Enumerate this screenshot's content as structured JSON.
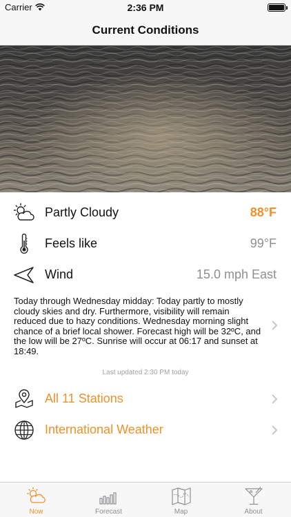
{
  "status_bar": {
    "carrier": "Carrier",
    "time": "2:36 PM"
  },
  "nav": {
    "title": "Current Conditions"
  },
  "conditions": {
    "summary_label": "Partly Cloudy",
    "summary_value": "88°F",
    "feels_like_label": "Feels like",
    "feels_like_value": "99°F",
    "wind_label": "Wind",
    "wind_value": "15.0 mph East"
  },
  "forecast_text": "Today through Wednesday midday: Today partly to mostly cloudy skies and dry. Furthermore, visibility will remain reduced due to hazy conditions. Wednesday morning slight chance of a brief local shower. Forecast high will be 32ºC, and the low will be 27ºC. Sunrise will occur at 06:17 and sunset at 18:49.",
  "last_updated": "Last updated 2:30 PM today",
  "links": {
    "stations": "All 11 Stations",
    "international": "International Weather"
  },
  "tabs": [
    {
      "label": "Now",
      "icon": "partly-cloudy-icon",
      "active": true
    },
    {
      "label": "Forecast",
      "icon": "bar-chart-icon",
      "active": false
    },
    {
      "label": "Map",
      "icon": "map-icon",
      "active": false
    },
    {
      "label": "About",
      "icon": "cocktail-icon",
      "active": false
    }
  ],
  "colors": {
    "accent": "#f0912a",
    "secondary_text": "#8e8e93"
  }
}
